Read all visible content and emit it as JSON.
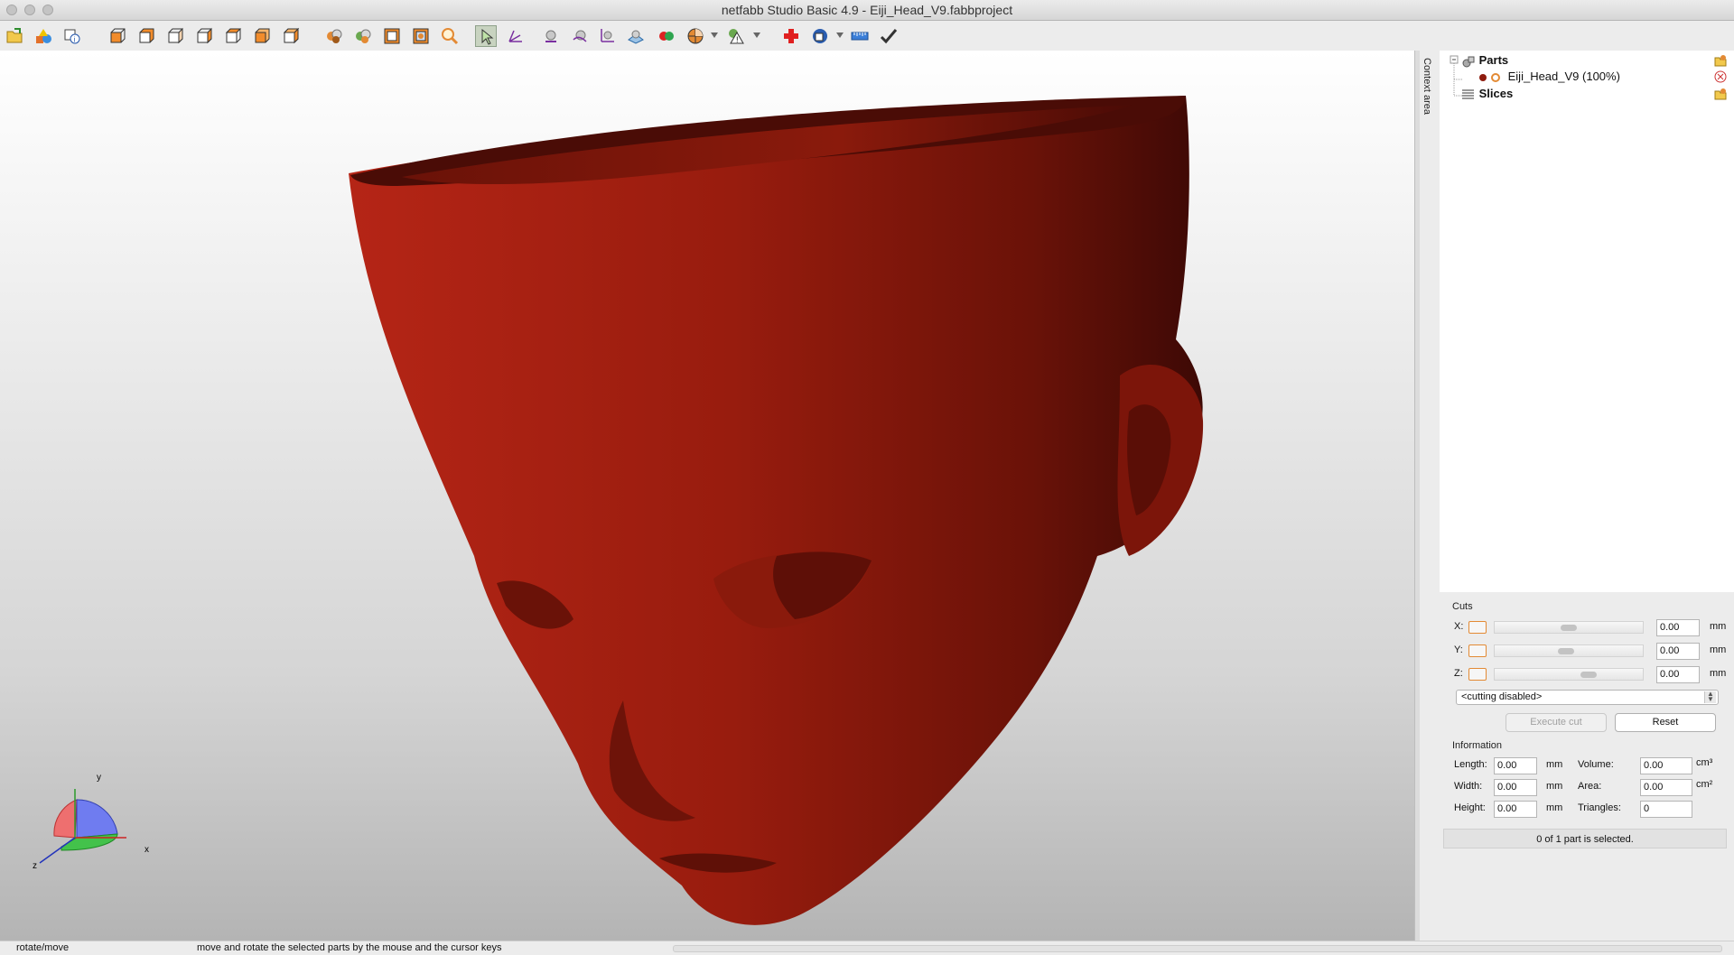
{
  "window": {
    "title": "netfabb Studio Basic 4.9 - Eiji_Head_V9.fabbproject"
  },
  "toolbar": {
    "groups": [
      [
        "open-project-icon",
        "add-part-icon",
        "part-info-icon"
      ],
      [
        "view-front-icon",
        "view-back-icon",
        "view-left-icon",
        "view-right-icon",
        "view-top-icon",
        "view-bottom-icon",
        "view-iso-icon"
      ],
      [
        "zoom-all-icon",
        "zoom-selection-icon",
        "zoom-box-icon",
        "zoom-window-icon",
        "zoom-magnify-icon"
      ],
      [
        "select-pointer-icon",
        "select-axes-icon",
        "select-sphere-icon",
        "select-mirror-icon",
        "select-points-icon",
        "select-plane-icon",
        "shading-toggle-icon",
        "color-mode-icon",
        "warning-markers-icon"
      ],
      [
        "repair-cross-icon",
        "measure-icon",
        "ruler-icon",
        "confirm-check-icon"
      ]
    ]
  },
  "viewport": {
    "model_color": "#8e1c0e",
    "axis_labels": {
      "x": "x",
      "y": "y",
      "z": "z"
    }
  },
  "sidebar": {
    "context_tab": "Context area"
  },
  "tree": {
    "parts_label": "Parts",
    "part_name": "Eiji_Head_V9 (100%)",
    "slices_label": "Slices"
  },
  "cuts": {
    "title": "Cuts",
    "axes": [
      {
        "label": "X:",
        "value": "0.00",
        "unit": "mm",
        "slider_pos": 0.5
      },
      {
        "label": "Y:",
        "value": "0.00",
        "unit": "mm",
        "slider_pos": 0.48
      },
      {
        "label": "Z:",
        "value": "0.00",
        "unit": "mm",
        "slider_pos": 0.65
      }
    ],
    "mode": "<cutting disabled>",
    "execute_label": "Execute cut",
    "reset_label": "Reset"
  },
  "information": {
    "title": "Information",
    "length": {
      "label": "Length:",
      "value": "0.00",
      "unit": "mm"
    },
    "width": {
      "label": "Width:",
      "value": "0.00",
      "unit": "mm"
    },
    "height": {
      "label": "Height:",
      "value": "0.00",
      "unit": "mm"
    },
    "volume": {
      "label": "Volume:",
      "value": "0.00",
      "unit": "cm³"
    },
    "area": {
      "label": "Area:",
      "value": "0.00",
      "unit": "cm²"
    },
    "triangles": {
      "label": "Triangles:",
      "value": "0"
    },
    "selection_status": "0 of 1 part is selected."
  },
  "statusbar": {
    "mode": "rotate/move",
    "hint": "move and rotate the selected parts by the mouse and the cursor keys"
  }
}
